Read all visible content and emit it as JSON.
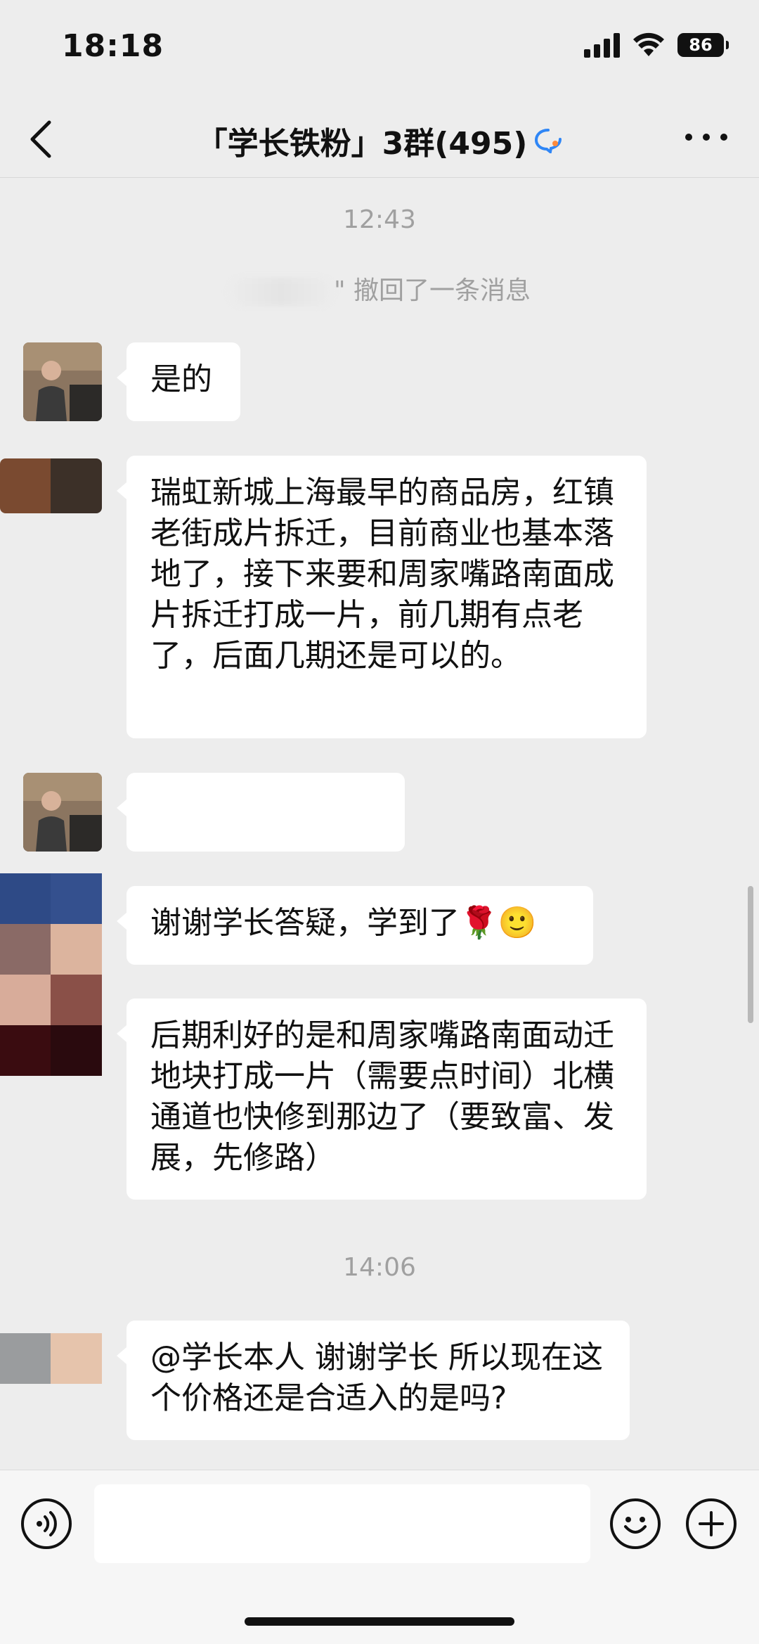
{
  "status_bar": {
    "time": "18:18",
    "battery": "86"
  },
  "header": {
    "title": "「学长铁粉」3群(495)",
    "back_icon": "chevron-left-icon",
    "more_icon": "more-dots-icon",
    "group_icon": "chat-bubble-icon"
  },
  "chat": {
    "timestamp_1": "12:43",
    "recall_text": "\" 撤回了一条消息",
    "messages": [
      {
        "text": "是的"
      },
      {
        "text": "瑞虹新城上海最早的商品房，红镇老街成片拆迁，目前商业也基本落地了，接下来要和周家嘴路南面成片拆迁打成一片，前几期有点老了，后面几期还是可以的。"
      },
      {
        "text": ""
      },
      {
        "text": "谢谢学长答疑，学到了"
      },
      {
        "text": "后期利好的是和周家嘴路南面动迁地块打成一片（需要点时间）北横通道也快修到那边了（要致富、发展，先修路）"
      },
      {
        "text": "@学长本人 谢谢学长 所以现在这个价格还是合适入的是吗?"
      }
    ],
    "timestamp_2": "14:06",
    "emoji": [
      "🌹",
      "🙂"
    ]
  },
  "input_bar": {
    "voice_icon": "voice-icon",
    "emoji_icon": "emoji-icon",
    "plus_icon": "plus-icon",
    "placeholder": ""
  },
  "colors": {
    "background": "#ededed",
    "bubble": "#ffffff",
    "timestamp": "#a0a0a0"
  }
}
